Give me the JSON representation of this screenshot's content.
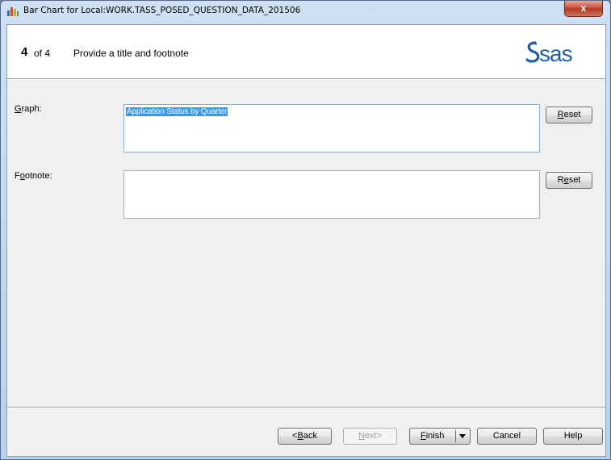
{
  "window": {
    "title": "Bar Chart for Local:WORK.TASS_POSED_QUESTION_DATA_201506",
    "close_glyph": "x",
    "app_icon": "bar-chart-icon"
  },
  "header": {
    "step_number": "4",
    "step_of": "of 4",
    "step_title": "Provide a title and footnote",
    "logo_text": "sas",
    "logo_color": "#1f5fa6"
  },
  "graph": {
    "label_pre": "",
    "label_ul": "G",
    "label_post": "raph:",
    "value": "Application Status by Quarter",
    "reset_pre": "",
    "reset_ul": "R",
    "reset_post": "eset"
  },
  "footnote": {
    "label_pre": "F",
    "label_ul": "o",
    "label_post": "otnote:",
    "value": "",
    "reset_pre": "R",
    "reset_ul": "e",
    "reset_post": "set"
  },
  "buttons": {
    "back_pre": "<",
    "back_ul": "B",
    "back_post": "ack",
    "next_pre": "",
    "next_ul": "N",
    "next_post": "ext>",
    "finish_pre": "",
    "finish_ul": "F",
    "finish_post": "inish",
    "cancel": "Cancel",
    "help": "Help"
  },
  "colors": {
    "selection": "#3399ff",
    "close_button": "#c7503a"
  }
}
